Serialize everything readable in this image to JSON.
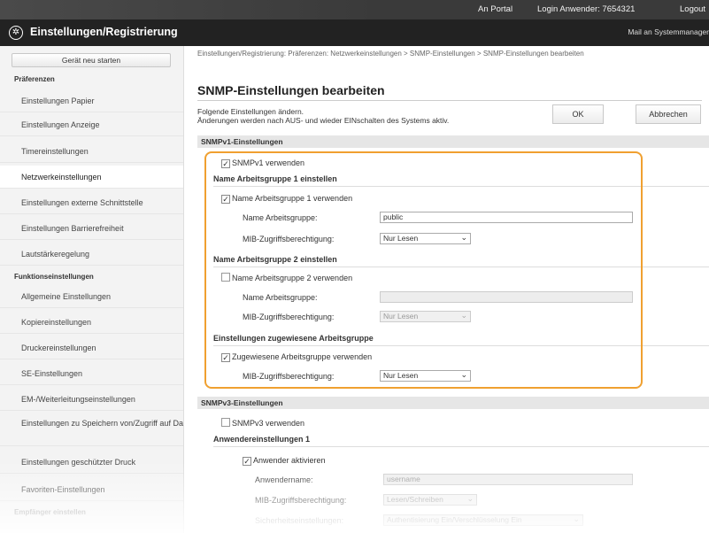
{
  "topbar": {
    "portal_label": "An Portal",
    "login_user": "Login Anwender: 7654321",
    "logout_label": "Logout"
  },
  "header": {
    "title": "Einstellungen/Registrierung",
    "mail_label": "Mail an Systemmanager"
  },
  "sidebar": {
    "restart_label": "Gerät neu starten",
    "sections": [
      {
        "label": "Präferenzen",
        "items": [
          "Einstellungen Papier",
          "Einstellungen Anzeige",
          "Timereinstellungen",
          "Netzwerkeinstellungen",
          "Einstellungen externe Schnittstelle",
          "Einstellungen Barrierefreiheit",
          "Lautstärkeregelung"
        ]
      },
      {
        "label": "Funktionseinstellungen",
        "items": [
          "Allgemeine Einstellungen",
          "Kopiereinstellungen",
          "Druckereinstellungen",
          "SE-Einstellungen",
          "EM-/Weiterleitungseinstellungen",
          "Einstellungen zu Speichern von/Zugriff auf Dateien",
          "Einstellungen geschützter Druck",
          "Favoriten-Einstellungen"
        ]
      },
      {
        "label": "Empfänger einstellen",
        "items": []
      }
    ],
    "active_item": "Netzwerkeinstellungen"
  },
  "main": {
    "breadcrumb": "Einstellungen/Registrierung: Präferenzen: Netzwerkeinstellungen > SNMP-Einstellungen > SNMP-Einstellungen bearbeiten",
    "title": "SNMP-Einstellungen bearbeiten",
    "intro_line1": "Folgende Einstellungen ändern.",
    "intro_line2": "Änderungen werden nach AUS- und wieder EINschalten des Systems aktiv.",
    "ok_label": "OK",
    "cancel_label": "Abbrechen",
    "snmpv1": {
      "section_label": "SNMPv1-Einstellungen",
      "use_label": "SNMPv1 verwenden",
      "use_checked": true,
      "group1": {
        "heading": "Name Arbeitsgruppe 1 einstellen",
        "use_label": "Name Arbeitsgruppe 1 verwenden",
        "use_checked": true,
        "name_label": "Name Arbeitsgruppe:",
        "name_value": "public",
        "mib_label": "MIB-Zugriffsberechtigung:",
        "mib_value": "Nur Lesen"
      },
      "group2": {
        "heading": "Name Arbeitsgruppe 2 einstellen",
        "use_label": "Name Arbeitsgruppe 2 verwenden",
        "use_checked": false,
        "name_label": "Name Arbeitsgruppe:",
        "name_value": "",
        "mib_label": "MIB-Zugriffsberechtigung:",
        "mib_value": "Nur Lesen"
      },
      "dedicated": {
        "heading": "Einstellungen zugewiesene Arbeitsgruppe",
        "use_label": "Zugewiesene Arbeitsgruppe verwenden",
        "use_checked": true,
        "mib_label": "MIB-Zugriffsberechtigung:",
        "mib_value": "Nur Lesen"
      }
    },
    "snmpv3": {
      "section_label": "SNMPv3-Einstellungen",
      "use_label": "SNMPv3 verwenden",
      "use_checked": false,
      "user1_heading": "Anwendereinstellungen 1",
      "enable_label": "Anwender aktivieren",
      "enable_checked": true,
      "user_name_label": "Anwendername:",
      "user_name_value": "username",
      "mib_label": "MIB-Zugriffsberechtigung:",
      "mib_value": "Lesen/Schreiben",
      "security_label": "Sicherheitseinstellungen:",
      "security_value": "Authentisierung Ein/Verschlüsselung Ein"
    }
  },
  "colors": {
    "highlight": "#f0a030",
    "header_bg": "#222222",
    "section_bar": "#e6e6e6"
  }
}
